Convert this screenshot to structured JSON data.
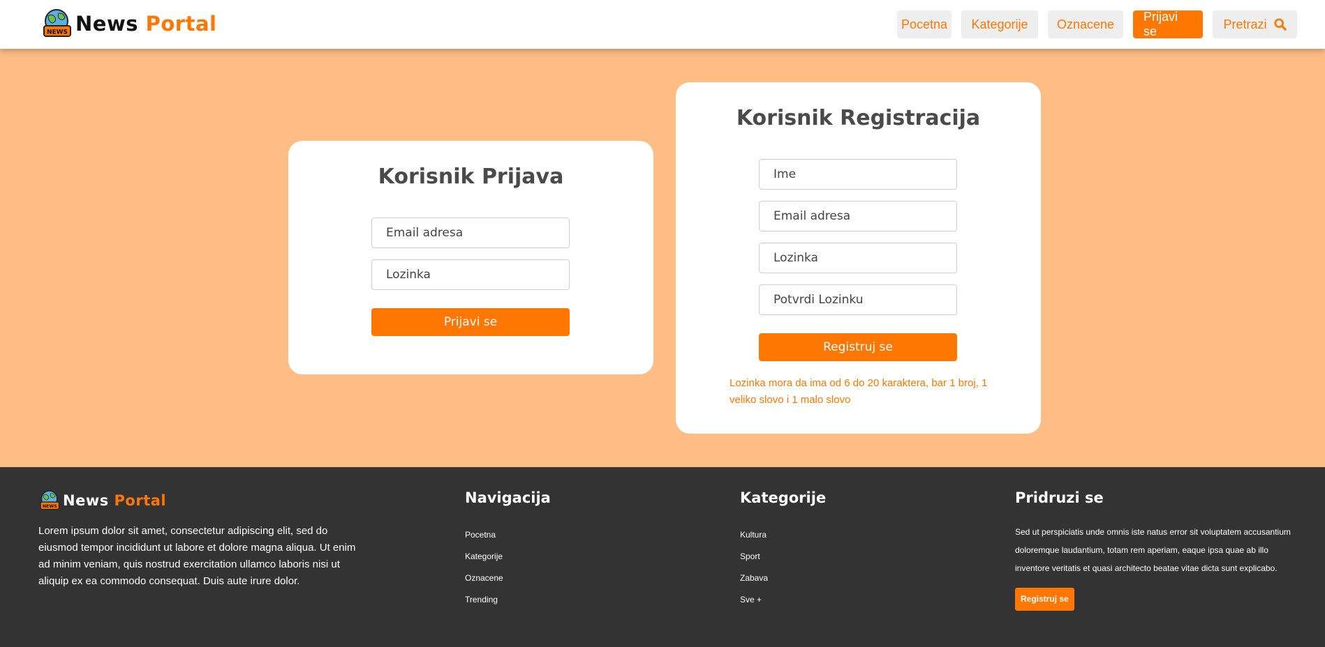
{
  "brand": {
    "word1": "News",
    "word2": "Portal",
    "badge": "NEWS"
  },
  "nav": {
    "home": "Pocetna",
    "categories": "Kategorije",
    "tagged": "Oznacene",
    "login": "Prijavi se",
    "search": "Pretrazi",
    "search_icon": "search-icon"
  },
  "login": {
    "title": "Korisnik Prijava",
    "email_placeholder": "Email adresa",
    "password_placeholder": "Lozinka",
    "submit": "Prijavi se"
  },
  "register": {
    "title": "Korisnik Registracija",
    "name_placeholder": "Ime",
    "email_placeholder": "Email adresa",
    "password_placeholder": "Lozinka",
    "confirm_placeholder": "Potvrdi Lozinku",
    "submit": "Registruj se",
    "hint": "Lozinka mora da ima od 6 do 20 karaktera, bar 1 broj, 1 veliko slovo i 1 malo slovo"
  },
  "footer": {
    "about": "Lorem ipsum dolor sit amet, consectetur adipiscing elit, sed do eiusmod tempor incididunt ut labore et dolore magna aliqua. Ut enim ad minim veniam, quis nostrud exercitation ullamco laboris nisi ut aliquip ex ea commodo consequat. Duis aute irure dolor.",
    "navigation": {
      "title": "Navigacija",
      "items": [
        "Pocetna",
        "Kategorije",
        "Oznacene",
        "Trending"
      ]
    },
    "categories": {
      "title": "Kategorije",
      "items": [
        "Kultura",
        "Sport",
        "Zabava",
        "Sve +"
      ]
    },
    "join": {
      "title": "Pridruzi se",
      "text": "Sed ut perspiciatis unde omnis iste natus error sit voluptatem accusantium doloremque laudantium, totam rem aperiam, eaque ipsa quae ab illo inventore veritatis et quasi architecto beatae vitae dicta sunt explicabo.",
      "button": "Registruj se"
    }
  },
  "colors": {
    "accent": "#fe7702",
    "page_bg": "#fdbd84",
    "footer_bg": "#333333"
  }
}
